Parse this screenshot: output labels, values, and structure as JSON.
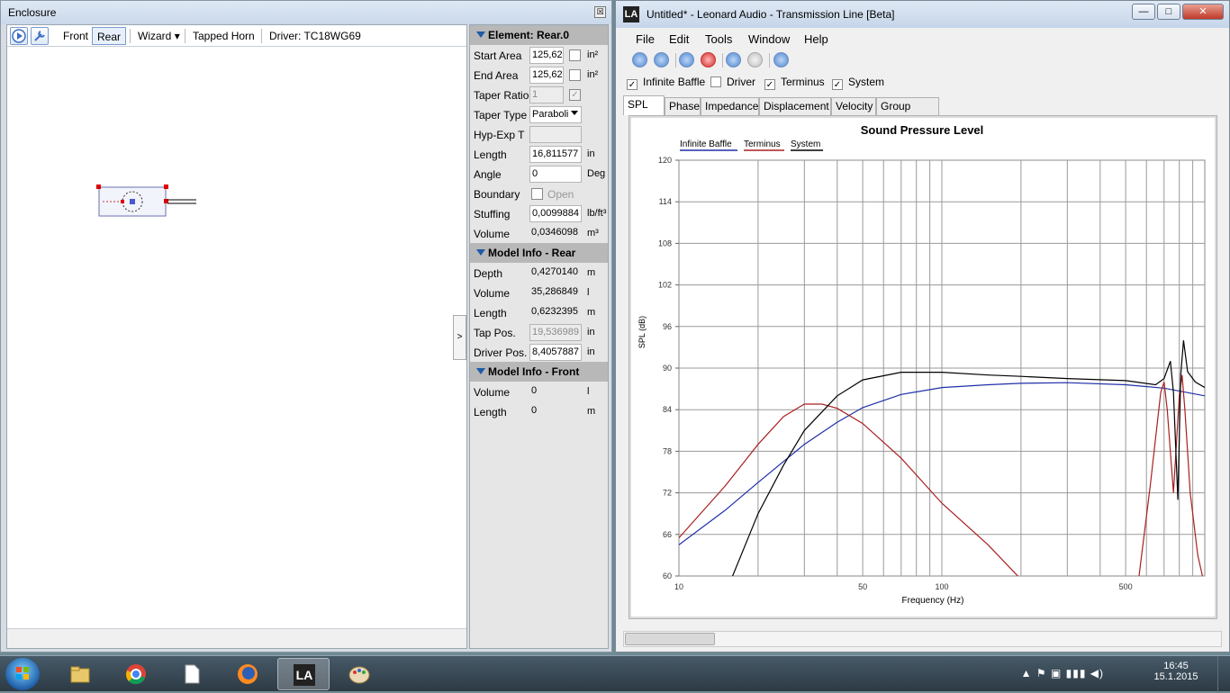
{
  "enclosure_window": {
    "title": "Enclosure",
    "close_glyph": "☒",
    "toolbar": {
      "front_label": "Front",
      "rear_label": "Rear",
      "wizard_label": "Wizard",
      "wizard_arrow": "▾",
      "tapped_horn_label": "Tapped Horn",
      "driver_label": "Driver: TC18WG69"
    },
    "splitter_glyph": ">",
    "element_header": "Element: Rear.0",
    "element_props": [
      {
        "label": "Start Area",
        "value": "125,62",
        "unit": "in²",
        "type": "input-check"
      },
      {
        "label": "End Area",
        "value": "125,62",
        "unit": "in²",
        "type": "input-check"
      },
      {
        "label": "Taper Ratio",
        "value": "1",
        "unit": "",
        "type": "disabled-check"
      },
      {
        "label": "Taper Type",
        "value": "Paraboli",
        "unit": "",
        "type": "select"
      },
      {
        "label": "Hyp-Exp T",
        "value": "",
        "unit": "",
        "type": "disabled"
      },
      {
        "label": "Length",
        "value": "16,811577",
        "unit": "in",
        "type": "input"
      },
      {
        "label": "Angle",
        "value": "0",
        "unit": "Deg",
        "type": "input"
      },
      {
        "label": "Boundary",
        "value": "Open",
        "unit": "",
        "type": "check-text"
      },
      {
        "label": "Stuffing",
        "value": "0,0099884",
        "unit": "lb/ft³",
        "type": "input"
      },
      {
        "label": "Volume",
        "value": "0,0346098",
        "unit": "m³",
        "type": "plain"
      }
    ],
    "model_rear_header": "Model Info - Rear",
    "model_rear": [
      {
        "label": "Depth",
        "value": "0,4270140",
        "unit": "m",
        "type": "plain"
      },
      {
        "label": "Volume",
        "value": "35,286849",
        "unit": "l",
        "type": "plain"
      },
      {
        "label": "Length",
        "value": "0,6232395",
        "unit": "m",
        "type": "plain"
      },
      {
        "label": "Tap Pos.",
        "value": "19,536989",
        "unit": "in",
        "type": "disabled"
      },
      {
        "label": "Driver Pos.",
        "value": "8,4057887",
        "unit": "in",
        "type": "input"
      }
    ],
    "model_front_header": "Model Info - Front",
    "model_front": [
      {
        "label": "Volume",
        "value": "0",
        "unit": "l",
        "type": "plain"
      },
      {
        "label": "Length",
        "value": "0",
        "unit": "m",
        "type": "plain"
      }
    ]
  },
  "la_window": {
    "title": "Untitled* - Leonard Audio - Transmission Line [Beta]",
    "logo_text": "LA",
    "window_buttons": {
      "minimize": "—",
      "maximize": "□",
      "close": "✕"
    },
    "menu": [
      "File",
      "Edit",
      "Tools",
      "Window",
      "Help"
    ],
    "checks": [
      {
        "label": "Infinite Baffle",
        "checked": true
      },
      {
        "label": "Driver",
        "checked": false
      },
      {
        "label": "Terminus",
        "checked": true
      },
      {
        "label": "System",
        "checked": true
      }
    ],
    "tabs": [
      "SPL",
      "Phase",
      "Impedance",
      "Displacement",
      "Velocity",
      "Group Delay"
    ],
    "active_tab": "SPL"
  },
  "chart_data": {
    "type": "line",
    "title": "Sound Pressure Level",
    "xlabel": "Frequency (Hz)",
    "ylabel": "SPL (dB)",
    "x_scale": "log",
    "xlim": [
      10,
      1000
    ],
    "ylim": [
      60,
      120
    ],
    "x_ticks": [
      10,
      50,
      100,
      500
    ],
    "y_ticks": [
      60,
      66,
      72,
      78,
      84,
      90,
      96,
      102,
      108,
      114,
      120
    ],
    "grid": true,
    "legend_position": "top-left",
    "series": [
      {
        "name": "Infinite Baffle",
        "color": "#1f2fa8",
        "points": [
          [
            10,
            64.5
          ],
          [
            15,
            69.5
          ],
          [
            20,
            73.5
          ],
          [
            30,
            79
          ],
          [
            40,
            82.2
          ],
          [
            50,
            84.3
          ],
          [
            70,
            86.2
          ],
          [
            100,
            87.2
          ],
          [
            150,
            87.6
          ],
          [
            200,
            87.8
          ],
          [
            300,
            87.9
          ],
          [
            500,
            87.6
          ],
          [
            700,
            87.1
          ],
          [
            1000,
            86
          ]
        ]
      },
      {
        "name": "Terminus",
        "color": "#a82020",
        "points": [
          [
            10,
            65.5
          ],
          [
            15,
            73
          ],
          [
            20,
            79
          ],
          [
            25,
            83
          ],
          [
            30,
            84.8
          ],
          [
            35,
            84.8
          ],
          [
            40,
            84.2
          ],
          [
            50,
            82
          ],
          [
            70,
            77
          ],
          [
            100,
            70.5
          ],
          [
            150,
            64.5
          ],
          [
            200,
            59.5
          ],
          [
            500,
            55
          ],
          [
            560,
            59.5
          ],
          [
            620,
            73
          ],
          [
            680,
            86.5
          ],
          [
            700,
            88
          ],
          [
            720,
            84
          ],
          [
            760,
            72
          ],
          [
            800,
            86
          ],
          [
            820,
            89
          ],
          [
            840,
            84
          ],
          [
            880,
            72
          ],
          [
            940,
            63
          ],
          [
            980,
            60
          ]
        ]
      },
      {
        "name": "System",
        "color": "#000000",
        "points": [
          [
            16,
            60
          ],
          [
            20,
            69
          ],
          [
            25,
            76
          ],
          [
            30,
            81
          ],
          [
            40,
            86
          ],
          [
            50,
            88.3
          ],
          [
            70,
            89.4
          ],
          [
            100,
            89.4
          ],
          [
            150,
            89
          ],
          [
            200,
            88.8
          ],
          [
            300,
            88.5
          ],
          [
            500,
            88.2
          ],
          [
            650,
            87.6
          ],
          [
            700,
            88.5
          ],
          [
            740,
            91
          ],
          [
            760,
            86.5
          ],
          [
            790,
            71
          ],
          [
            810,
            89
          ],
          [
            830,
            94
          ],
          [
            860,
            89.5
          ],
          [
            920,
            88
          ],
          [
            1000,
            87.2
          ]
        ]
      }
    ]
  },
  "taskbar": {
    "apps": [
      {
        "name": "explorer"
      },
      {
        "name": "chrome"
      },
      {
        "name": "document"
      },
      {
        "name": "firefox"
      },
      {
        "name": "leonard-audio",
        "text": "LA",
        "active": true
      },
      {
        "name": "paint"
      }
    ],
    "tray_icons": "▲  ⚑  ▣  ▮▮▮  ◀)",
    "time": "16:45",
    "date": "15.1.2015"
  }
}
